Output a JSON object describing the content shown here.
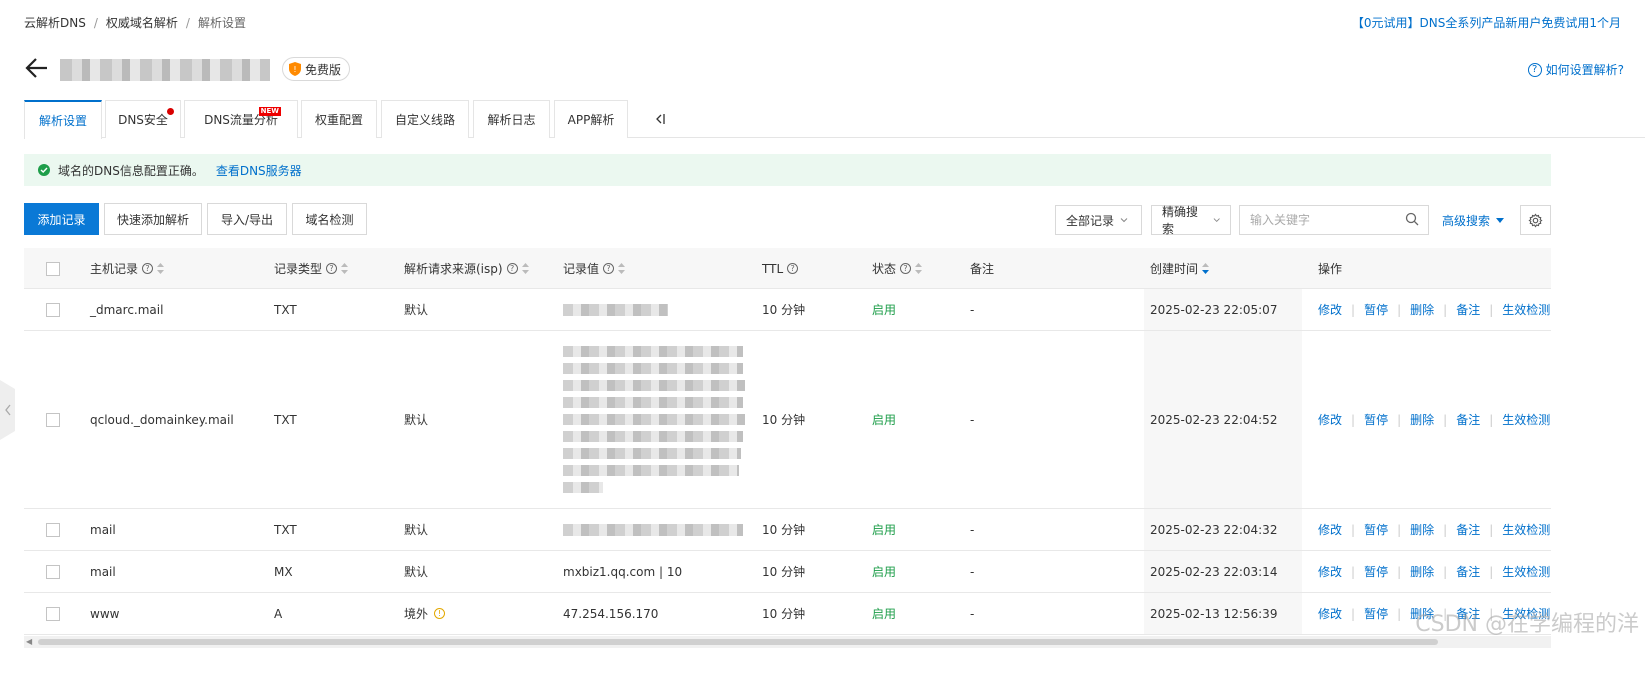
{
  "breadcrumb": [
    "云解析DNS",
    "权威域名解析",
    "解析设置"
  ],
  "promo_text": "【0元试用】DNS全系列产品新用户免费试用1个月",
  "badge_free": "免费版",
  "help_link": "如何设置解析?",
  "tabs": [
    {
      "label": "解析设置",
      "active": true
    },
    {
      "label": "DNS安全",
      "dot": true
    },
    {
      "label": "DNS流量分析",
      "badge": "NEW"
    },
    {
      "label": "权重配置"
    },
    {
      "label": "自定义线路"
    },
    {
      "label": "解析日志"
    },
    {
      "label": "APP解析"
    }
  ],
  "alert": {
    "text": "域名的DNS信息配置正确。",
    "link": "查看DNS服务器"
  },
  "toolbar": {
    "add_record": "添加记录",
    "quick_add": "快速添加解析",
    "import_export": "导入/导出",
    "domain_check": "域名检测",
    "filter_select": "全部记录",
    "match_select": "精确搜索",
    "search_placeholder": "输入关键字",
    "advanced_search": "高级搜索"
  },
  "columns": {
    "host": "主机记录",
    "type": "记录类型",
    "isp": "解析请求来源(isp)",
    "value": "记录值",
    "ttl": "TTL",
    "status": "状态",
    "remark": "备注",
    "created": "创建时间",
    "ops": "操作"
  },
  "operations": [
    "修改",
    "暂停",
    "删除",
    "备注",
    "生效检测"
  ],
  "rows": [
    {
      "host": "_dmarc.mail",
      "type": "TXT",
      "isp": "默认",
      "value": "",
      "ttl": "10 分钟",
      "status": "启用",
      "remark": "-",
      "created": "2025-02-23 22:05:07"
    },
    {
      "host": "qcloud._domainkey.mail",
      "type": "TXT",
      "isp": "默认",
      "value": "",
      "ttl": "10 分钟",
      "status": "启用",
      "remark": "-",
      "created": "2025-02-23 22:04:52"
    },
    {
      "host": "mail",
      "type": "TXT",
      "isp": "默认",
      "value": "",
      "ttl": "10 分钟",
      "status": "启用",
      "remark": "-",
      "created": "2025-02-23 22:04:32"
    },
    {
      "host": "mail",
      "type": "MX",
      "isp": "默认",
      "value": "mxbiz1.qq.com | 10",
      "ttl": "10 分钟",
      "status": "启用",
      "remark": "-",
      "created": "2025-02-23 22:03:14"
    },
    {
      "host": "www",
      "type": "A",
      "isp": "境外",
      "value": "47.254.156.170",
      "ttl": "10 分钟",
      "status": "启用",
      "remark": "-",
      "created": "2025-02-13 12:56:39"
    }
  ],
  "watermark": "CSDN @在学编程的洋"
}
